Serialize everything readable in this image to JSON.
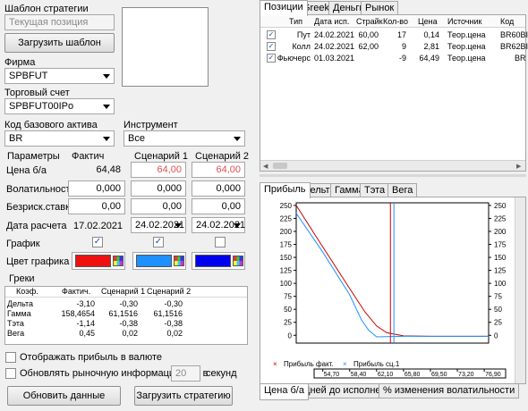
{
  "left": {
    "strategy_template_label": "Шаблон стратегии",
    "strategy_template_value": "Текущая позиция",
    "load_template_button": "Загрузить шаблон",
    "firm_label": "Фирма",
    "firm_value": "SPBFUT",
    "account_label": "Торговый счет",
    "account_value": "SPBFUT00IPo",
    "base_asset_label": "Код базового актива",
    "base_asset_value": "BR",
    "instrument_label": "Инструмент",
    "instrument_value": "Все",
    "params_header": "Параметры",
    "fact_header": "Фактич",
    "scen1_header": "Сценарий 1",
    "scen2_header": "Сценарий 2",
    "price_label": "Цена б/а",
    "price_fact": "64,48",
    "price_s1": "64,00",
    "price_s2": "64,00",
    "vol_label": "Волатильность",
    "vol_fact": "0,000",
    "vol_s1": "0,000",
    "vol_s2": "0,000",
    "rate_label": "Безриск.ставка",
    "rate_fact": "0,00",
    "rate_s1": "0,00",
    "rate_s2": "0,00",
    "calc_date_label": "Дата расчета",
    "calc_date_fact": "17.02.2021",
    "calc_date_s1": "24.02.2021",
    "calc_date_s2": "24.02.2021",
    "chart_label": "График",
    "color_label": "Цвет графика",
    "colors": {
      "fact": "#ee1111",
      "s1": "#1e90ff",
      "s2": "#0000ee"
    }
  },
  "greeks": {
    "title": "Греки",
    "headers": [
      "Коэф.",
      "Фактич.",
      "Сценарий 1",
      "Сценарий 2"
    ],
    "rows": [
      [
        "Дельта",
        "-3,10",
        "-0,30",
        "-0,30"
      ],
      [
        "Гамма",
        "158,4654",
        "61,1516",
        "61,1516"
      ],
      [
        "Тэта",
        "-1,14",
        "-0,38",
        "-0,38"
      ],
      [
        "Вега",
        "0,45",
        "0,02",
        "0,02"
      ]
    ]
  },
  "options": {
    "show_currency": "Отображать прибыль в валюте",
    "refresh_prefix": "Обновлять рыночную информацию раз в",
    "refresh_value": "20",
    "refresh_suffix": "секунд",
    "update_button": "Обновить данные",
    "load_strategy_button": "Загрузить стратегию"
  },
  "positions": {
    "tabs": [
      "Позиции",
      "Greeks",
      "Деньги",
      "Рынок"
    ],
    "headers": [
      "Тип",
      "Дата исп.",
      "Страйк",
      "Кол-во",
      "Цена",
      "Источник",
      "Код"
    ],
    "rows": [
      [
        "Пут",
        "24.02.2021",
        "60,00",
        "17",
        "0,14",
        "Теор.цена",
        "BR60BI"
      ],
      [
        "Колл",
        "24.02.2021",
        "62,00",
        "9",
        "2,81",
        "Теор.цена",
        "BR62BI"
      ],
      [
        "Фьючерс",
        "01.03.2021",
        "",
        "-9",
        "64,49",
        "Теор.цена",
        "BR"
      ]
    ]
  },
  "chart_tabs": [
    "Прибыль",
    "Дельта",
    "Гамма",
    "Тэта",
    "Вега"
  ],
  "bottom_tabs": [
    "Цена б/а",
    "Дней до исполнения",
    "% изменения волатильности"
  ],
  "chart_data": {
    "type": "line",
    "ylim": [
      -15,
      255
    ],
    "xlim": [
      51.05,
      77.5
    ],
    "y_ticks": [
      "250",
      "225",
      "200",
      "175",
      "150",
      "125",
      "100",
      "75",
      "50",
      "25",
      "0"
    ],
    "x_ticks": [
      "54,70",
      "58,40",
      "62,10",
      "65,80",
      "69,50",
      "73,20",
      "76,90"
    ],
    "legend": [
      "Прибыль факт.",
      "Прибыль сц.1"
    ],
    "series": [
      {
        "name": "Прибыль факт.",
        "color": "#cc0000",
        "points": [
          [
            51.05,
            250
          ],
          [
            54.7,
            170
          ],
          [
            58.4,
            90
          ],
          [
            60.5,
            45
          ],
          [
            62.1,
            18
          ],
          [
            63.5,
            5
          ],
          [
            65.8,
            -1
          ],
          [
            69.5,
            -2
          ],
          [
            77.5,
            -2
          ]
        ]
      },
      {
        "name": "Прибыль сц.1",
        "color": "#1e90ff",
        "points": [
          [
            51.05,
            235
          ],
          [
            54.7,
            160
          ],
          [
            58.4,
            78
          ],
          [
            60.0,
            30
          ],
          [
            61.0,
            10
          ],
          [
            62.1,
            -3
          ],
          [
            65.8,
            -2
          ],
          [
            77.5,
            -2
          ]
        ]
      }
    ],
    "markers": [
      {
        "x": 64.0,
        "color": "#cc0000"
      },
      {
        "x": 64.48,
        "color": "#1e90ff"
      }
    ]
  }
}
